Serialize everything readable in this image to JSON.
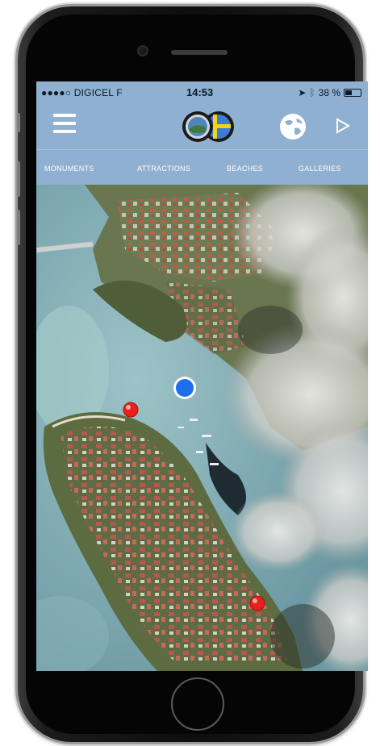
{
  "status_bar": {
    "carrier": "●●●●○ DIGICEL F",
    "time": "14:53",
    "battery": "38 %"
  },
  "nav": {
    "menu_icon": "hamburger-menu-icon",
    "logo_icons": [
      "island-logo-icon",
      "swedish-flag-icon"
    ],
    "globe_icon": "globe-icon",
    "play_icon": "play-triangle-icon"
  },
  "tabs": [
    {
      "label": "MONUMENTS"
    },
    {
      "label": "ATTRACTIONS"
    },
    {
      "label": "BEACHES"
    },
    {
      "label": "GALLERIES"
    }
  ],
  "map": {
    "current_location_color": "#1e6ff0",
    "pin_color": "#e8221b"
  }
}
